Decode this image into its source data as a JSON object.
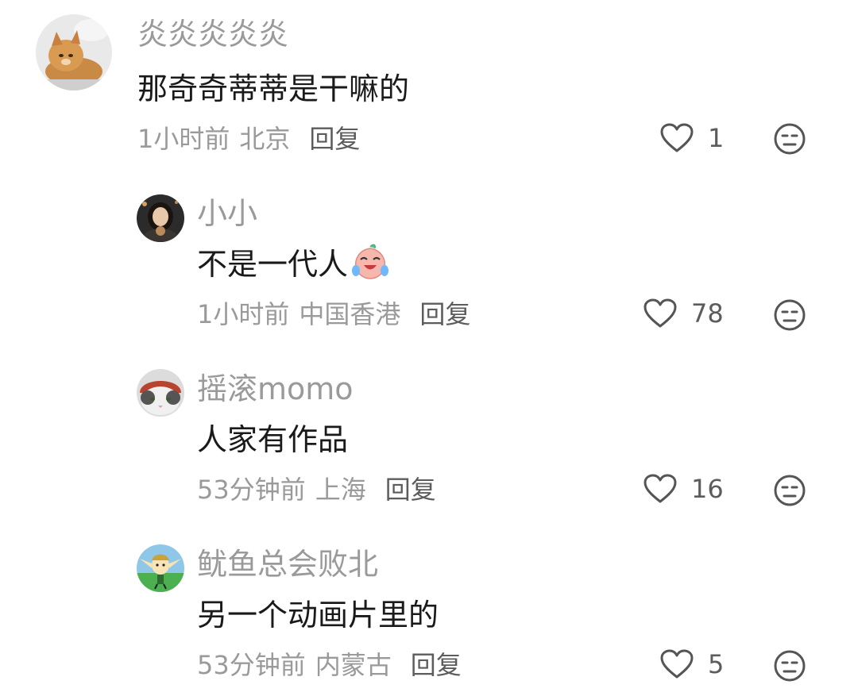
{
  "comments": [
    {
      "username": "炎炎炎炎炎",
      "content": "那奇奇蒂蒂是干嘛的",
      "time": "1小时前",
      "location": "北京",
      "reply_label": "回复",
      "likes": "1",
      "avatar_icon": "orange-cat-avatar"
    },
    {
      "username": "小小",
      "content": "不是一代人",
      "content_emoji": "laugh-cry-emoji",
      "time": "1小时前",
      "location": "中国香港",
      "reply_label": "回复",
      "likes": "78",
      "avatar_icon": "woman-portrait-avatar"
    },
    {
      "username": "摇滚momo",
      "content": "人家有作品",
      "time": "53分钟前",
      "location": "上海",
      "reply_label": "回复",
      "likes": "16",
      "avatar_icon": "cat-with-red-hat-avatar"
    },
    {
      "username": "鱿鱼总会败北",
      "content": "另一个动画片里的",
      "time": "53分钟前",
      "location": "内蒙古",
      "reply_label": "回复",
      "likes": "5",
      "avatar_icon": "cartoon-elf-avatar"
    }
  ],
  "colors": {
    "username": "#9a9a9a",
    "content": "#1a1a1a",
    "meta": "#9a9a9a",
    "icon": "#555555"
  }
}
